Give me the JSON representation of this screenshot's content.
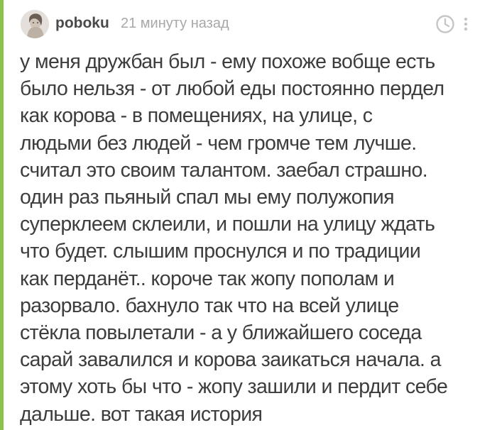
{
  "comment": {
    "author": {
      "username": "poboku",
      "avatar_icon": "avatar-image"
    },
    "timestamp": "21 минуту назад",
    "actions": {
      "clock_icon": "clock-icon",
      "more_icon": "vertical-dots-icon"
    },
    "text_lines": [
      "у меня дружбан был - ему похоже вобще есть",
      "было нельзя - от любой еды постоянно пердел",
      "как корова - в помещениях, на улице, с",
      "людьми без людей - чем громче тем лучше.",
      "считал это своим талантом. заебал страшно.",
      "один раз пьяный спал мы ему полужопия",
      "суперклеем склеили, и пошли на улицу ждать",
      "что будет. слышим проснулся и по традиции",
      "как перданёт.. короче так жопу пополам и",
      "разорвало. бахнуло так что на всей улице",
      "стёкла повылетали - а у ближайшего соседа",
      "сарай завалился и корова заикаться начала. а",
      "этому хоть бы что - жопу зашили и пердит себе",
      "дальше. вот такая история"
    ]
  },
  "colors": {
    "thread_line": "#8bc34a",
    "username": "#4a4a4a",
    "timestamp": "#a8a8a8",
    "text": "#3d3d3d",
    "icons": "#c6c6c6"
  }
}
